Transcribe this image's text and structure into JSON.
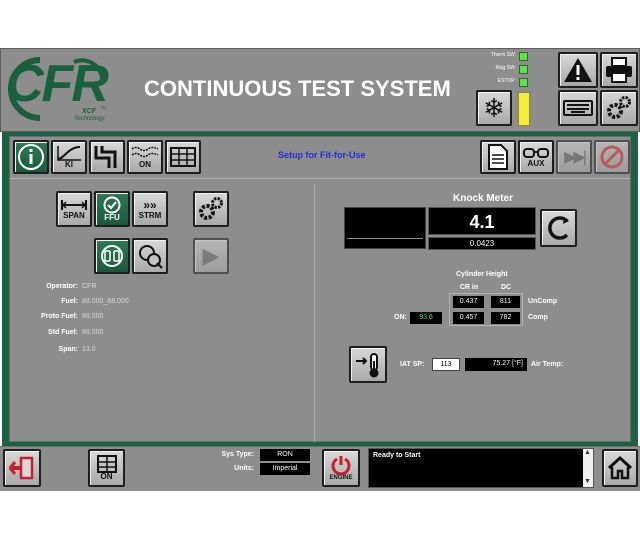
{
  "header": {
    "logo_text": "CFR",
    "logo_sub1": "XCF",
    "logo_tm": "TM",
    "logo_sub2": "Technology",
    "title": "CONTINUOUS TEST SYSTEM",
    "indicators": [
      {
        "label": "Therm SW:",
        "color": "#59e54a"
      },
      {
        "label": "Mag SW:",
        "color": "#59e54a"
      },
      {
        "label": "ESTOP:",
        "color": "#59e54a"
      }
    ],
    "level_color": "#f2ee3a"
  },
  "toolbar": {
    "center_text": "Setup for Fit-for-Use",
    "ki_label": "KI",
    "on_label": "ON",
    "aux_label": "AUX"
  },
  "left": {
    "span_label": "SPAN",
    "ffu_label": "FFU",
    "strm_label": "STRM",
    "fields": [
      {
        "label": "Operator:",
        "value": "CFR"
      },
      {
        "label": "Fuel:",
        "value": "88.000_88.000"
      },
      {
        "label": "Proto Fuel:",
        "value": "88.000"
      },
      {
        "label": "Std Fuel:",
        "value": "88.000"
      },
      {
        "label": "Span:",
        "value": "13.0"
      }
    ]
  },
  "knock": {
    "title": "Knock Meter",
    "value": "4.1",
    "sub_value": "0.0423"
  },
  "cylinder": {
    "title": "Cylinder Height",
    "col_cr": "CR in",
    "col_dc": "DC",
    "uncomp_cr": "0.437",
    "uncomp_dc": "811",
    "uncomp_label": "UnComp",
    "comp_cr": "0.457",
    "comp_dc": "782",
    "comp_label": "Comp",
    "on_label": "ON:",
    "on_value": "93.6"
  },
  "iat": {
    "label": "IAT SP:",
    "sp": "113",
    "air_temp": "75.27 [°F]",
    "air_label": "Air Temp:"
  },
  "footer": {
    "on_label": "ON",
    "sys_type_label": "Sys Type:",
    "sys_type": "RON",
    "units_label": "Units:",
    "units": "Imperial",
    "engine_label": "ENGINE",
    "status": "Ready to Start"
  }
}
